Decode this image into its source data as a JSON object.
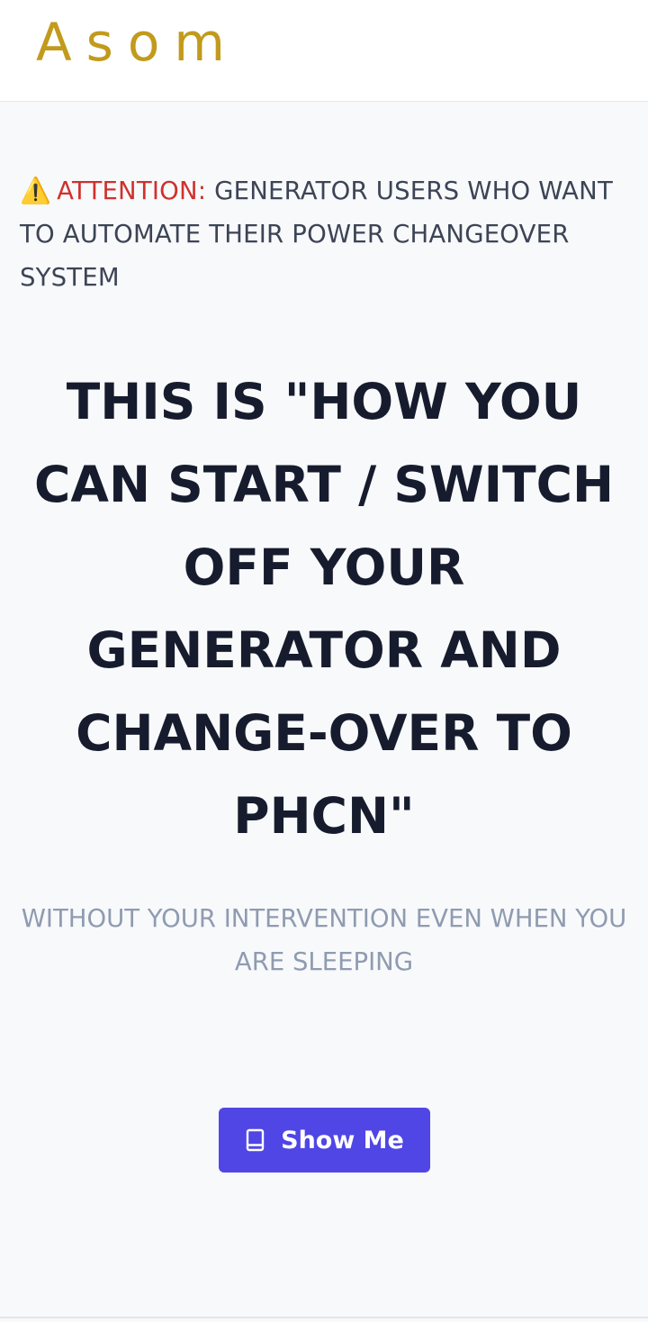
{
  "header": {
    "logo_text": "Asom"
  },
  "attention": {
    "icon": "warning-icon",
    "label": "ATTENTION:",
    "text": " GENERATOR USERS WHO WANT TO AUTOMATE THEIR POWER CHANGEOVER SYSTEM"
  },
  "headline": {
    "text": "THIS IS \"HOW YOU CAN START / SWITCH OFF YOUR GENERATOR AND CHANGE-OVER TO PHCN\""
  },
  "subtitle": {
    "text": "WITHOUT YOUR INTERVENTION EVEN WHEN YOU ARE SLEEPING"
  },
  "cta": {
    "icon": "book-icon",
    "label": "Show Me"
  },
  "colors": {
    "brand_gold": "#c29a1c",
    "attention_red": "#d0312d",
    "button_indigo": "#5046e5",
    "headline_dark": "#161c2d",
    "subtitle_gray": "#8f9bb0"
  }
}
